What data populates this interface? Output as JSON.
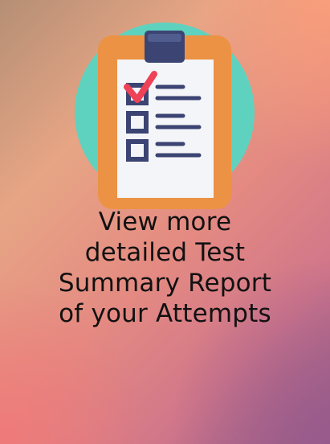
{
  "promo": {
    "lines": [
      "View more",
      "detailed Test",
      "Summary Report",
      "of your Attempts"
    ]
  },
  "icons": {
    "illustration": "clipboard-checklist-icon"
  },
  "colors": {
    "circle": "#5fd2bf",
    "board": "#ec9244",
    "clip": "#3b4472",
    "paper": "#f4f5f8",
    "lines": "#3b4472",
    "check": "#ef4257",
    "text": "#111111"
  }
}
